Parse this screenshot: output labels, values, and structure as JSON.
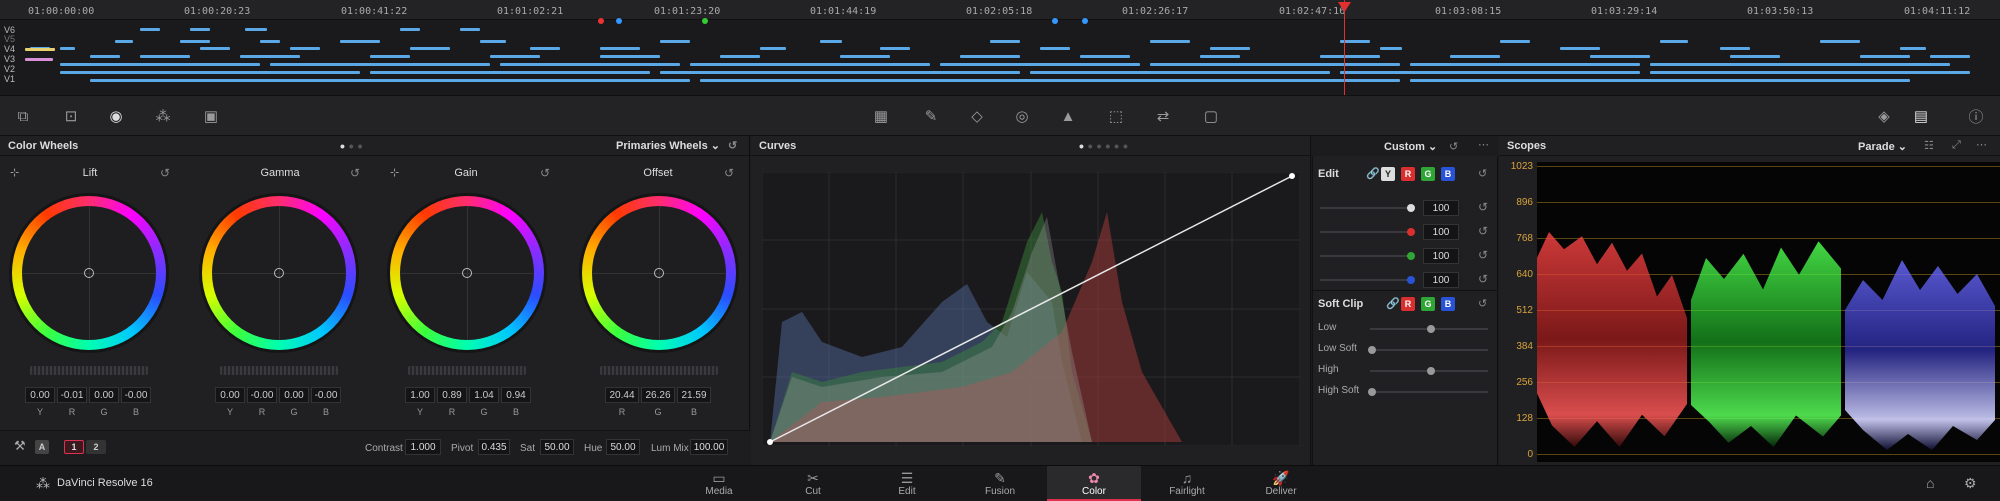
{
  "timeline": {
    "timecodes": [
      "01:00:00:00",
      "01:00:20:23",
      "01:00:41:22",
      "01:01:02:21",
      "01:01:23:20",
      "01:01:44:19",
      "01:02:05:18",
      "01:02:26:17",
      "01:02:47:16",
      "01:03:08:15",
      "01:03:29:14",
      "01:03:50:13",
      "01:04:11:12"
    ],
    "tracks": [
      "V6",
      "V5",
      "V4",
      "V3",
      "V2",
      "V1"
    ]
  },
  "color_wheels": {
    "title": "Color Wheels",
    "mode": "Primaries Wheels",
    "wheels": [
      {
        "name": "Lift",
        "values": [
          "0.00",
          "-0.01",
          "0.00",
          "-0.00"
        ],
        "channels": [
          "Y",
          "R",
          "G",
          "B"
        ]
      },
      {
        "name": "Gamma",
        "values": [
          "0.00",
          "-0.00",
          "0.00",
          "-0.00"
        ],
        "channels": [
          "Y",
          "R",
          "G",
          "B"
        ]
      },
      {
        "name": "Gain",
        "values": [
          "1.00",
          "0.89",
          "1.04",
          "0.94"
        ],
        "channels": [
          "Y",
          "R",
          "G",
          "B"
        ]
      },
      {
        "name": "Offset",
        "values": [
          "20.44",
          "26.26",
          "21.59"
        ],
        "channels": [
          "R",
          "G",
          "B"
        ]
      }
    ],
    "adjust": {
      "page1": "1",
      "page2": "2",
      "contrast_label": "Contrast",
      "contrast": "1.000",
      "pivot_label": "Pivot",
      "pivot": "0.435",
      "sat_label": "Sat",
      "sat": "50.00",
      "hue_label": "Hue",
      "hue": "50.00",
      "lummix_label": "Lum Mix",
      "lummix": "100.00"
    }
  },
  "curves": {
    "title": "Curves",
    "mode": "Custom"
  },
  "edit": {
    "title": "Edit",
    "chips": [
      "Y",
      "R",
      "G",
      "B"
    ],
    "values": [
      "100",
      "100",
      "100",
      "100"
    ],
    "softclip_title": "Soft Clip",
    "softclip_labels": [
      "Low",
      "Low Soft",
      "High",
      "High Soft"
    ]
  },
  "scopes": {
    "title": "Scopes",
    "mode": "Parade",
    "scale": [
      "1023",
      "896",
      "768",
      "640",
      "512",
      "384",
      "256",
      "128",
      "0"
    ]
  },
  "bottom": {
    "app_name": "DaVinci Resolve 16",
    "pages": [
      {
        "label": "Media",
        "icon": "▭"
      },
      {
        "label": "Cut",
        "icon": "✂"
      },
      {
        "label": "Edit",
        "icon": "☰"
      },
      {
        "label": "Fusion",
        "icon": "✎"
      },
      {
        "label": "Color",
        "icon": "✿"
      },
      {
        "label": "Fairlight",
        "icon": "♫"
      },
      {
        "label": "Deliver",
        "icon": "🚀"
      }
    ]
  },
  "colors": {
    "accent": "#e03050",
    "clip": "#5aa9e6",
    "playhead": "#e03030"
  }
}
